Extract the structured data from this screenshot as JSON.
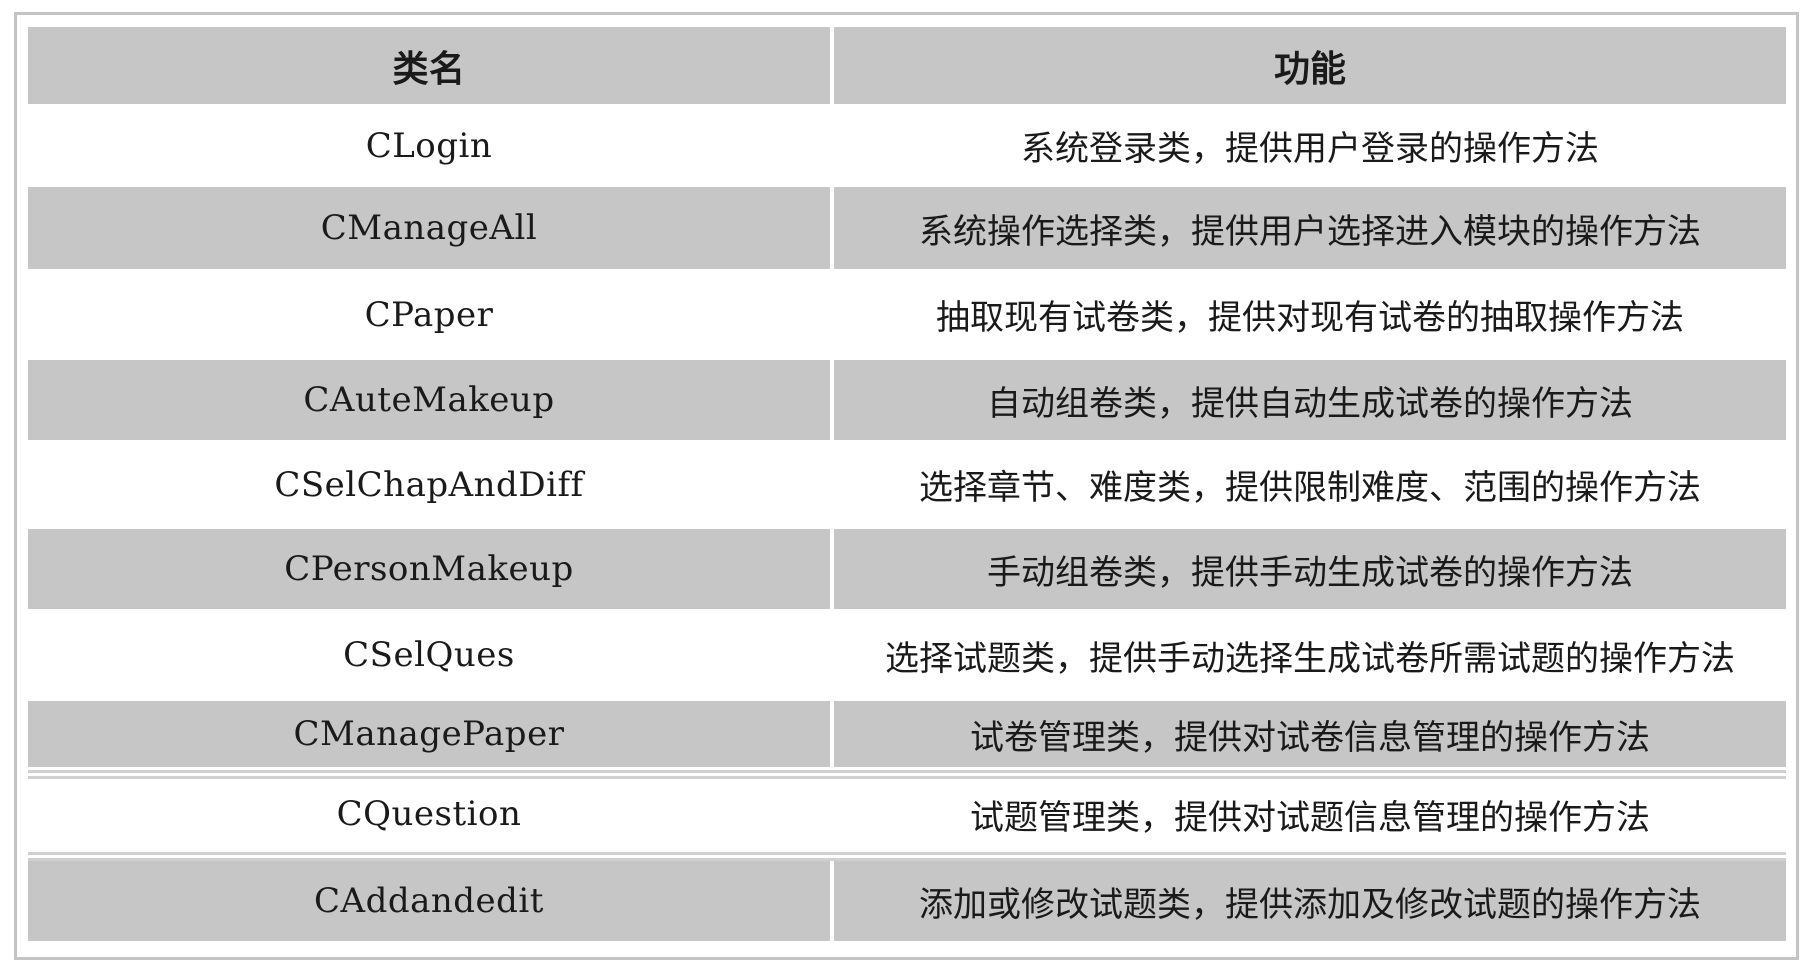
{
  "table": {
    "headers": [
      "类名",
      "功能"
    ],
    "rows": [
      {
        "name": "CLogin",
        "desc": "系统登录类，提供用户登录的操作方法"
      },
      {
        "name": "CManageAll",
        "desc": "系统操作选择类，提供用户选择进入模块的操作方法"
      },
      {
        "name": "CPaper",
        "desc": "抽取现有试卷类，提供对现有试卷的抽取操作方法"
      },
      {
        "name": "CAuteMakeup",
        "desc": "自动组卷类，提供自动生成试卷的操作方法"
      },
      {
        "name": "CSelChapAndDiff",
        "desc": "选择章节、难度类，提供限制难度、范围的操作方法"
      },
      {
        "name": "CPersonMakeup",
        "desc": "手动组卷类，提供手动生成试卷的操作方法"
      },
      {
        "name": "CSelQues",
        "desc": "选择试题类，提供手动选择生成试卷所需试题的操作方法"
      },
      {
        "name": "CManagePaper",
        "desc": "试卷管理类，提供对试卷信息管理的操作方法"
      },
      {
        "name": "CQuestion",
        "desc": "试题管理类，提供对试题信息管理的操作方法"
      },
      {
        "name": "CAddandedit",
        "desc": "添加或修改试题类，提供添加及修改试题的操作方法"
      }
    ]
  },
  "colors": {
    "gray_row": "#c6c6c6",
    "white_row": "#ffffff",
    "border": "#c4c4c4"
  }
}
